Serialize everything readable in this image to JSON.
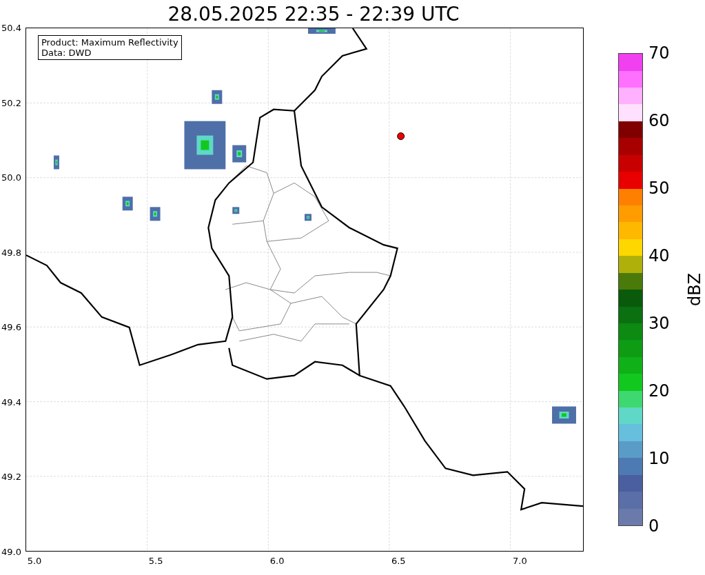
{
  "title": "28.05.2025 22:35 - 22:39 UTC",
  "info_box": [
    "Product: Maximum Reflectivity",
    "Data: DWD"
  ],
  "map": {
    "y_ticks": [
      "50.4",
      "50.2",
      "50.0",
      "49.8",
      "49.6",
      "49.4",
      "49.2",
      "49.0"
    ],
    "x_ticks": [
      "5.0",
      "5.5",
      "6.0",
      "6.5",
      "7.0"
    ]
  },
  "colorbar": {
    "label": "dBZ",
    "ticks": [
      "70",
      "60",
      "50",
      "40",
      "30",
      "20",
      "10",
      "0"
    ]
  }
}
